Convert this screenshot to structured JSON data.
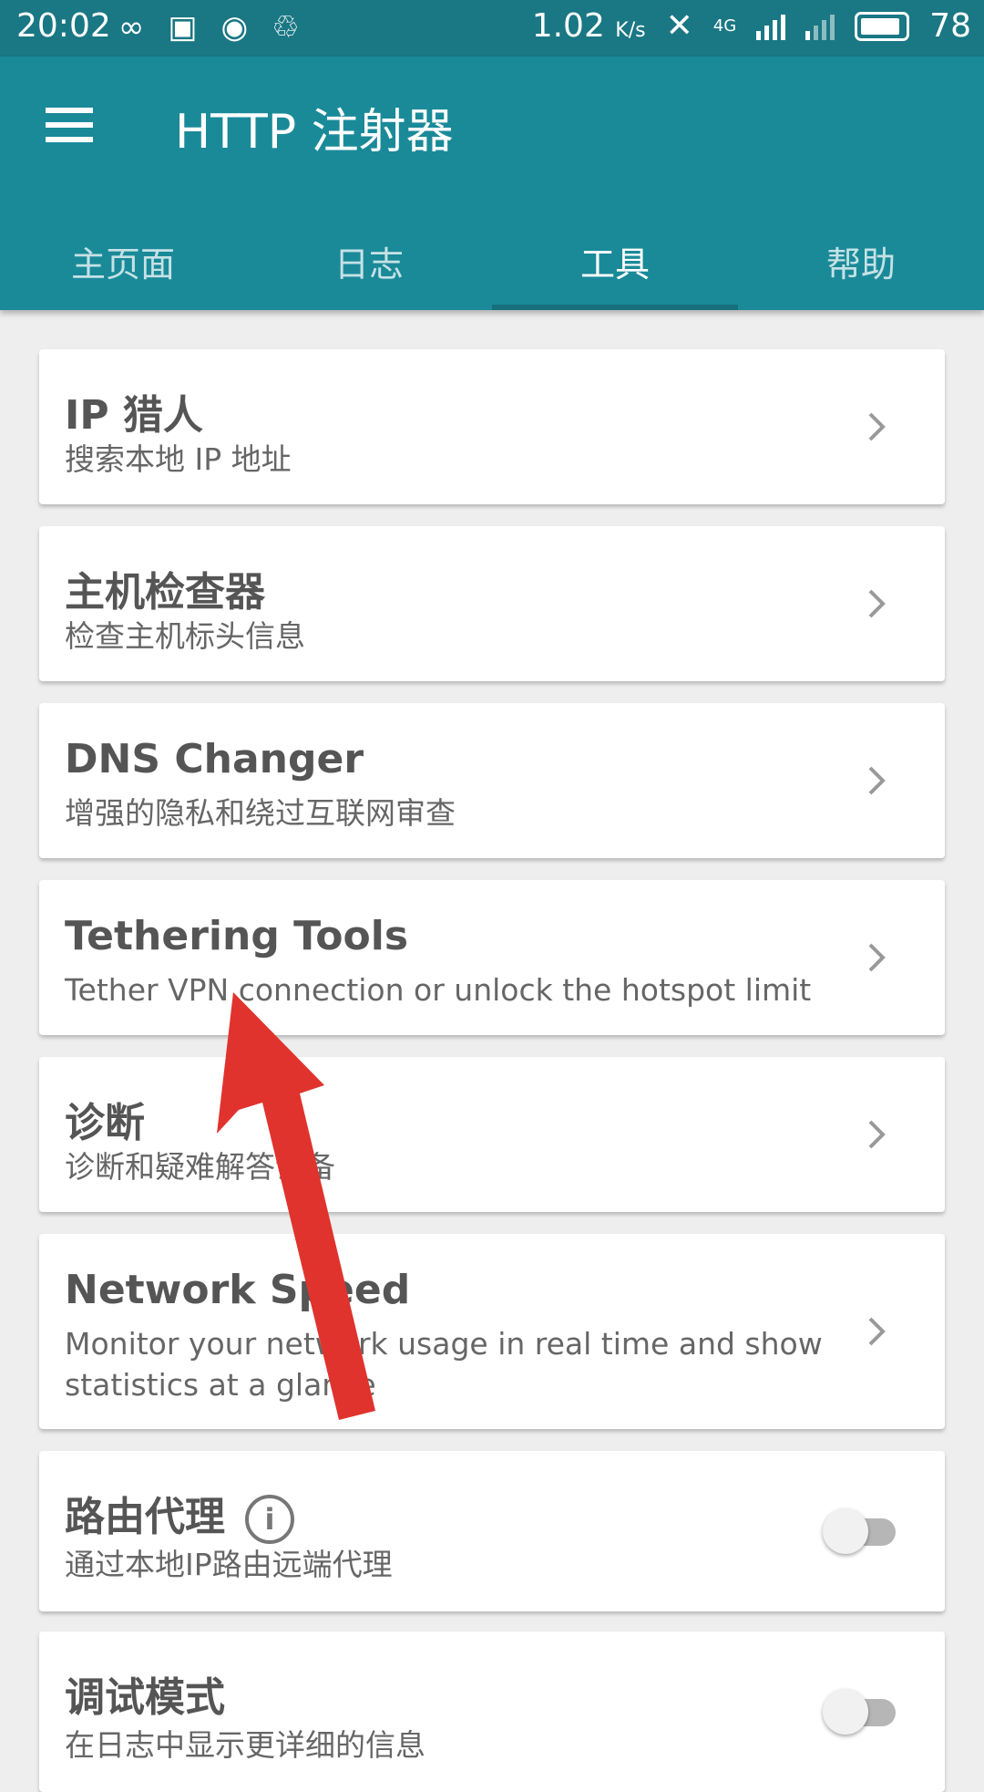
{
  "status_bar": {
    "time": "20:02",
    "speed": "1.02",
    "speed_unit": "K/s",
    "network": "4G",
    "battery": "78",
    "icons": [
      "infinity-icon",
      "image-icon",
      "hotspot-icon",
      "share-icon",
      "mute-icon",
      "signal-icon",
      "battery-icon"
    ]
  },
  "app_bar": {
    "title": "HTTP 注射器",
    "tabs": [
      "主页面",
      "日志",
      "工具",
      "帮助"
    ],
    "active_tab": "工具"
  },
  "tools": [
    {
      "title": "IP 猎人",
      "subtitle": "搜索本地 IP 地址",
      "control": "chevron"
    },
    {
      "title": "主机检查器",
      "subtitle": "检查主机标头信息",
      "control": "chevron"
    },
    {
      "title": "DNS Changer",
      "subtitle": "增强的隐私和绕过互联网审查",
      "control": "chevron"
    },
    {
      "title": "Tethering Tools",
      "subtitle": "Tether VPN connection or unlock the hotspot limit",
      "control": "chevron"
    },
    {
      "title": "诊断",
      "subtitle": "诊断和疑难解答设备",
      "control": "chevron"
    },
    {
      "title": "Network Speed",
      "subtitle": "Monitor your network usage in real time and show statistics at a glance",
      "control": "chevron"
    },
    {
      "title": "路由代理",
      "subtitle": "通过本地IP路由远端代理",
      "control": "toggle",
      "toggle_on": false
    },
    {
      "title": "调试模式",
      "subtitle": "在日志中显示更详细的信息",
      "control": "toggle",
      "toggle_on": false
    }
  ],
  "colors": {
    "status_bar": "#1a7784",
    "app_bar": "#1a8a99",
    "annotation_arrow": "#e0332d"
  }
}
